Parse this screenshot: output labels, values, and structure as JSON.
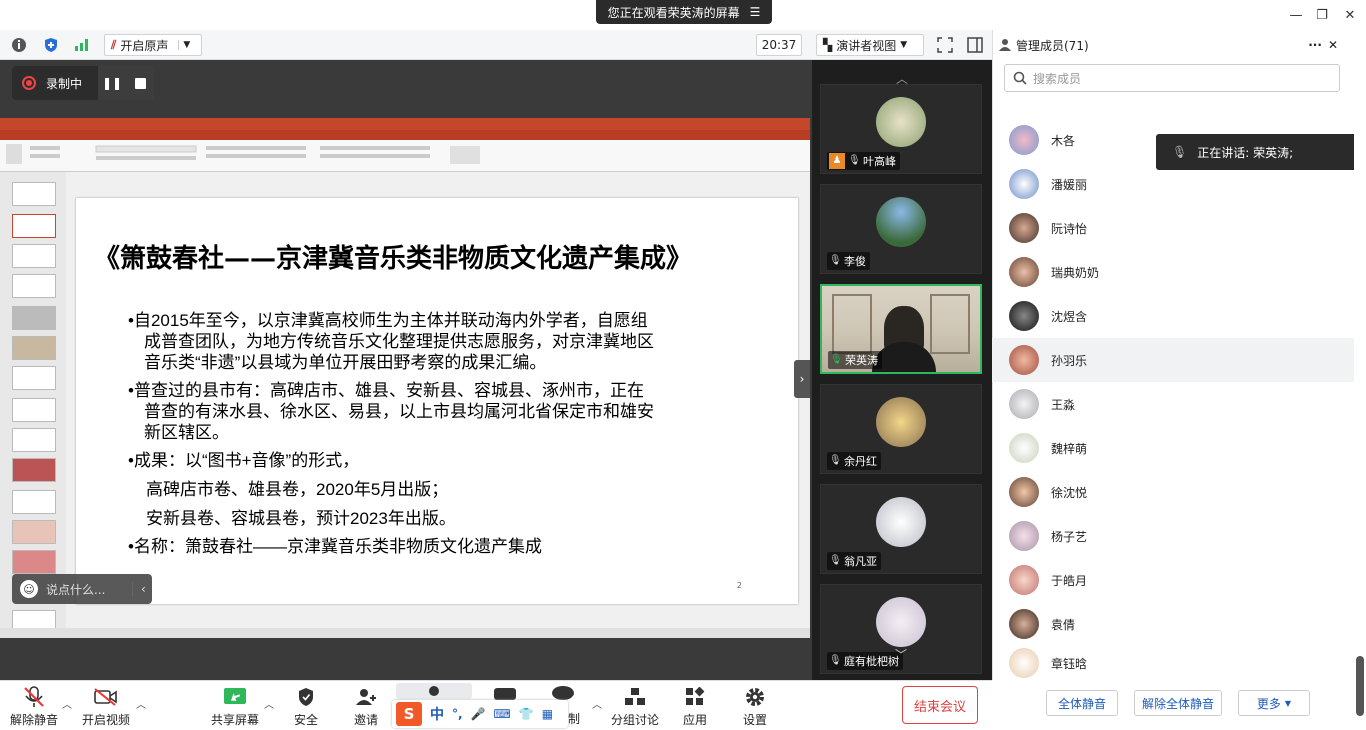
{
  "window": {
    "banner_text": "您正在观看荣英涛的屏幕"
  },
  "toolbar": {
    "original_sound_label": "开启原声",
    "time": "20:37",
    "view_label": "演讲者视图"
  },
  "recording": {
    "label": "录制中"
  },
  "slide": {
    "title": "《箫鼓春社——京津冀音乐类非物质文化遗产集成》",
    "bullets": [
      {
        "line1": "•自2015年至今，以京津冀高校师生为主体并联动海内外学者，自愿组",
        "line2": "成普查团队，为地方传统音乐文化整理提供志愿服务，对京津冀地区",
        "line3": "音乐类“非遗”以县域为单位开展田野考察的成果汇编。"
      },
      {
        "line1": "•普查过的县市有：高碑店市、雄县、安新县、容城县、涿州市，正在",
        "line2": "普查的有涞水县、徐水区、易县，以上市县均属河北省保定市和雄安",
        "line3": "新区辖区。"
      },
      {
        "line1": "•成果：以“图书+音像”的形式，",
        "line2": "高碑店市卷、雄县卷，2020年5月出版；",
        "line3": "安新县卷、容城县卷，预计2023年出版。"
      },
      {
        "line1": "•名称：箫鼓春社——京津冀音乐类非物质文化遗产集成"
      }
    ],
    "page_number": "2"
  },
  "chat": {
    "placeholder": "说点什么..."
  },
  "videos": [
    {
      "name": "叶高峰"
    },
    {
      "name": "李俊"
    },
    {
      "name": "荣英涛"
    },
    {
      "name": "余丹红"
    },
    {
      "name": "翁凡亚"
    },
    {
      "name": "庭有枇杷树"
    }
  ],
  "panel": {
    "title": "管理成员(71)",
    "search_placeholder": "搜索成员",
    "speaking": "正在讲话: 荣英涛;",
    "members": [
      "木各",
      "潘媛丽",
      "阮诗怡",
      "瑞典奶奶",
      "沈煜含",
      "孙羽乐",
      "王淼",
      "魏梓萌",
      "徐沈悦",
      "杨子艺",
      "于皓月",
      "袁倩",
      "章钰晗"
    ],
    "mute_all": "全体静音",
    "unmute_all": "解除全体静音",
    "more": "更多"
  },
  "bottom": {
    "unmute": "解除静音",
    "video": "开启视频",
    "share": "共享屏幕",
    "security": "安全",
    "invite": "邀请",
    "record_partial": "制",
    "breakout": "分组讨论",
    "apps": "应用",
    "settings": "设置",
    "end_meeting": "结束会议"
  },
  "ime": {
    "lang": "中"
  },
  "colors": {
    "accent_green": "#2fb85a",
    "ppt_red": "#c4462b",
    "end_red": "#e04040",
    "link_blue": "#1e5bb8"
  }
}
